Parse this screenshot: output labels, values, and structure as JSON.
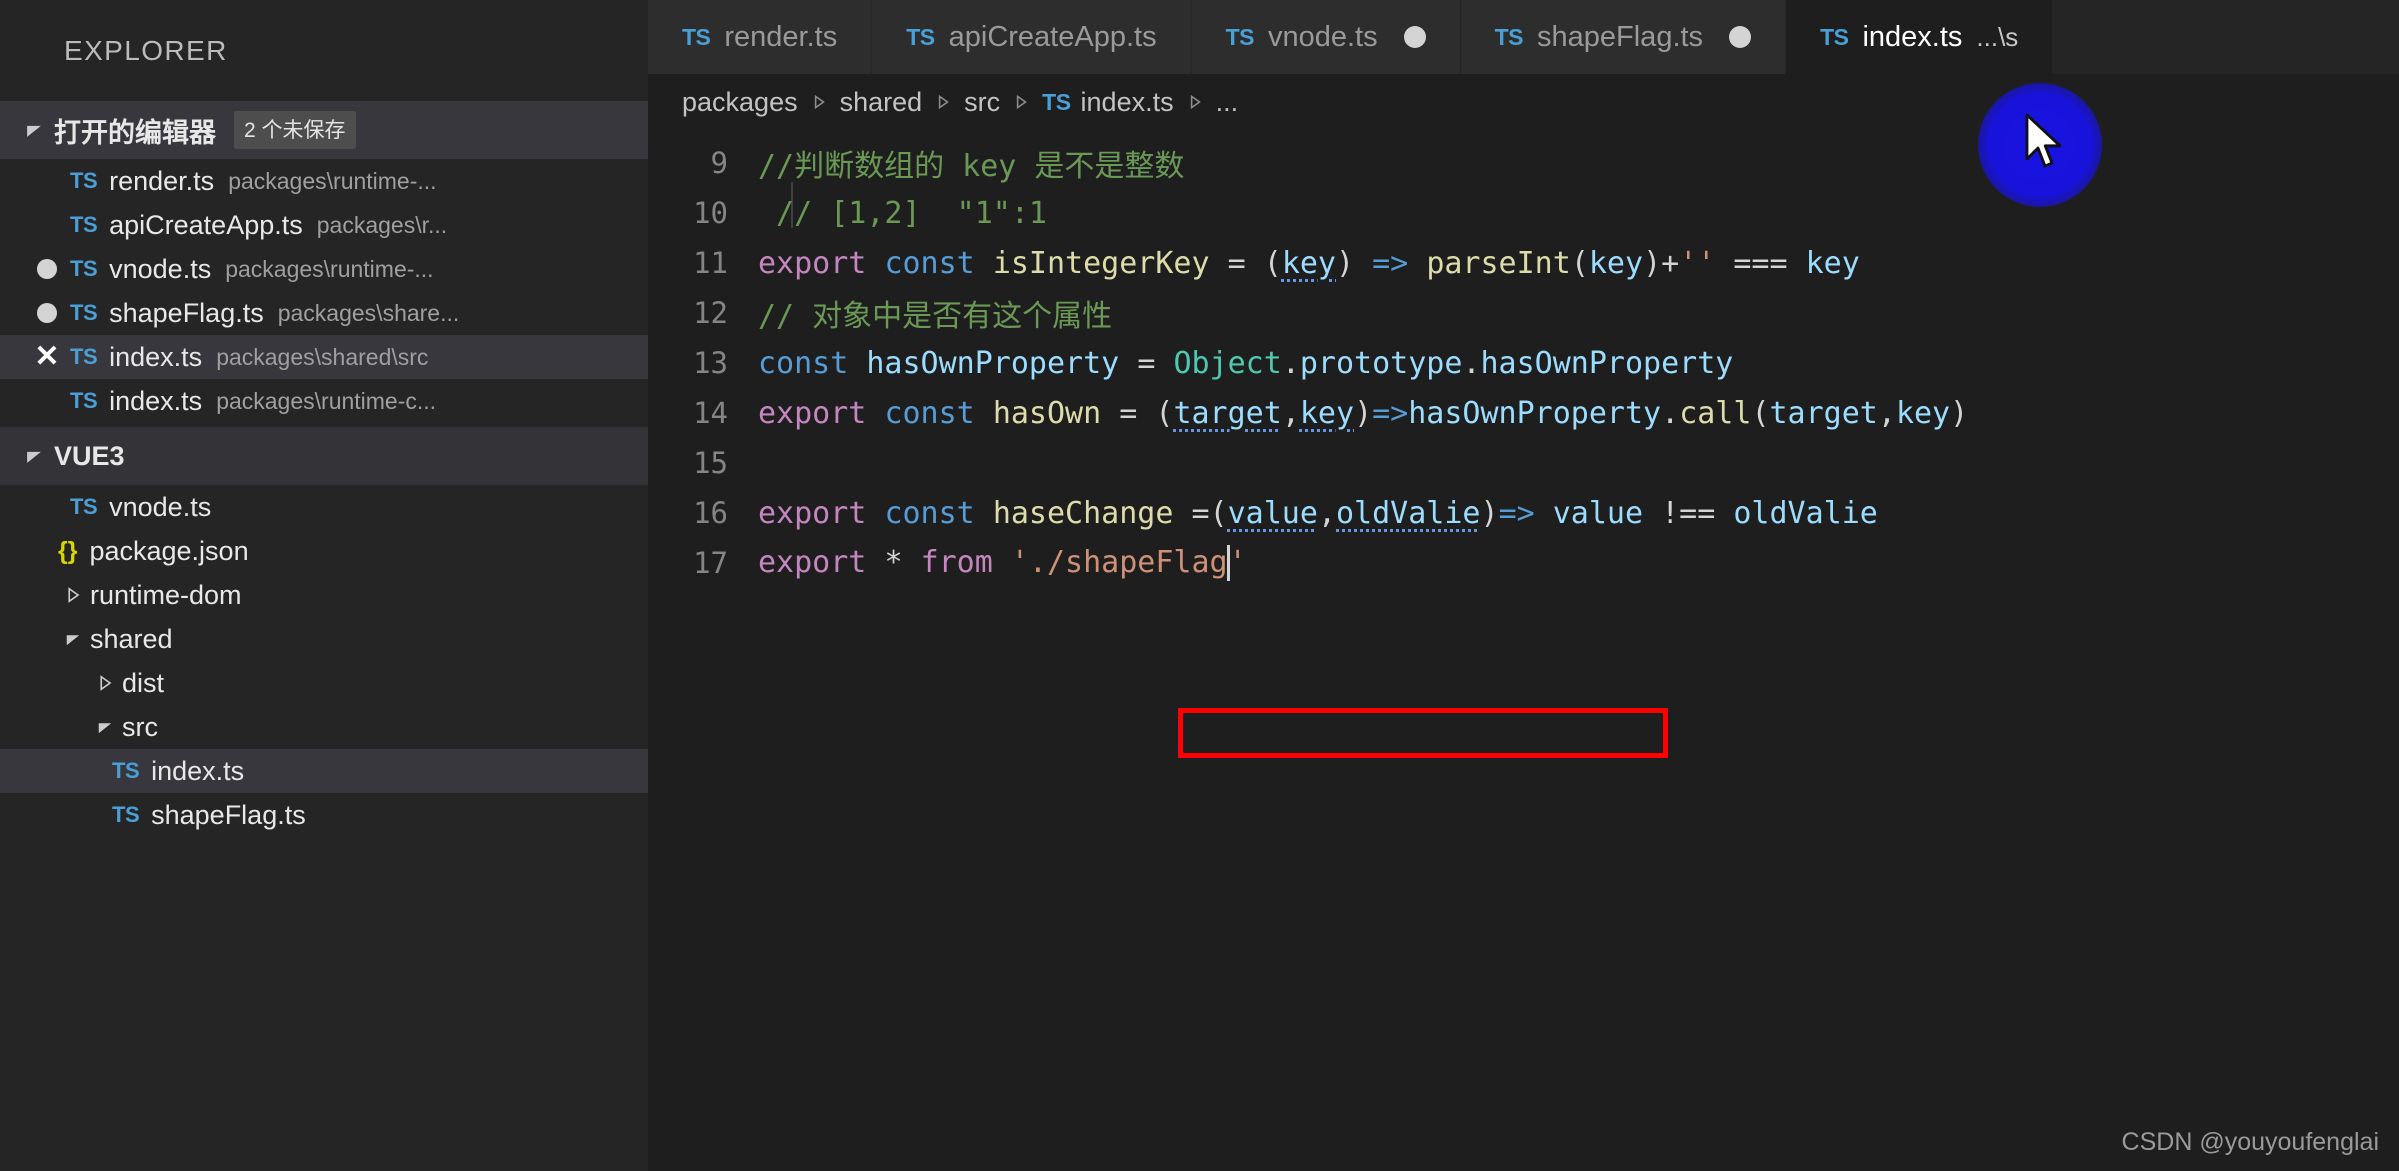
{
  "sidebar": {
    "title": "EXPLORER",
    "open_editors": {
      "label": "打开的编辑器",
      "badge": "2 个未保存",
      "items": [
        {
          "state": "none",
          "icon": "ts-file-icon",
          "name": "render.ts",
          "path": "packages\\runtime-..."
        },
        {
          "state": "none",
          "icon": "ts-file-icon",
          "name": "apiCreateApp.ts",
          "path": "packages\\r..."
        },
        {
          "state": "modified",
          "icon": "ts-file-icon",
          "name": "vnode.ts",
          "path": "packages\\runtime-..."
        },
        {
          "state": "modified",
          "icon": "ts-file-icon",
          "name": "shapeFlag.ts",
          "path": "packages\\share..."
        },
        {
          "state": "close",
          "icon": "ts-file-icon",
          "name": "index.ts",
          "path": "packages\\shared\\src",
          "selected": true
        },
        {
          "state": "none",
          "icon": "ts-file-icon",
          "name": "index.ts",
          "path": "packages\\runtime-c..."
        }
      ]
    },
    "workspace": {
      "label": "VUE3",
      "items": [
        {
          "kind": "file",
          "icon": "ts-file-icon",
          "name": "vnode.ts",
          "depth": 2
        },
        {
          "kind": "file",
          "icon": "json-file-icon",
          "name": "package.json",
          "depth": 2
        },
        {
          "kind": "folder",
          "icon": "chevron-right-icon",
          "name": "runtime-dom",
          "depth": 1,
          "expanded": false
        },
        {
          "kind": "folder",
          "icon": "chevron-down-icon",
          "name": "shared",
          "depth": 1,
          "expanded": true
        },
        {
          "kind": "folder",
          "icon": "chevron-right-icon",
          "name": "dist",
          "depth": 2,
          "expanded": false
        },
        {
          "kind": "folder",
          "icon": "chevron-down-icon",
          "name": "src",
          "depth": 2,
          "expanded": true
        },
        {
          "kind": "file",
          "icon": "ts-file-icon",
          "name": "index.ts",
          "depth": 3,
          "selected": true
        },
        {
          "kind": "file",
          "icon": "ts-file-icon",
          "name": "shapeFlag.ts",
          "depth": 3
        }
      ]
    }
  },
  "tabs": [
    {
      "label": "render.ts",
      "sub": "",
      "modified": false,
      "active": false
    },
    {
      "label": "apiCreateApp.ts",
      "sub": "",
      "modified": false,
      "active": false
    },
    {
      "label": "vnode.ts",
      "sub": "",
      "modified": true,
      "active": false
    },
    {
      "label": "shapeFlag.ts",
      "sub": "",
      "modified": true,
      "active": false
    },
    {
      "label": "index.ts",
      "sub": "...\\s",
      "modified": false,
      "active": true
    }
  ],
  "breadcrumb": {
    "items": [
      "packages",
      "shared",
      "src",
      "index.ts"
    ],
    "overflow": "..."
  },
  "code": {
    "first_line_number": 9,
    "lines": [
      {
        "n": "9",
        "text": "//判断数组的 key 是不是整数"
      },
      {
        "n": "10",
        "text": "// [1,2]  \"1\":1"
      },
      {
        "n": "11",
        "text": "export const isIntegerKey = (key) => parseInt(key)+'' === key"
      },
      {
        "n": "12",
        "text": "// 对象中是否有这个属性"
      },
      {
        "n": "13",
        "text": "const hasOwnProperty = Object.prototype.hasOwnProperty"
      },
      {
        "n": "14",
        "text": "export const hasOwn = (target,key)=>hasOwnProperty.call(target,key)"
      },
      {
        "n": "15",
        "text": ""
      },
      {
        "n": "16",
        "text": "export const haseChange =(value,oldValie)=> value !== oldValie"
      },
      {
        "n": "17",
        "text": "export * from './shapeFlag'"
      }
    ],
    "highlight_box_line": "17",
    "highlight_color": "#ff0000"
  },
  "overlay": {
    "click_indicator_color": "#1812eb",
    "cursor": "mouse-pointer"
  },
  "watermark": "CSDN @youyoufenglai"
}
